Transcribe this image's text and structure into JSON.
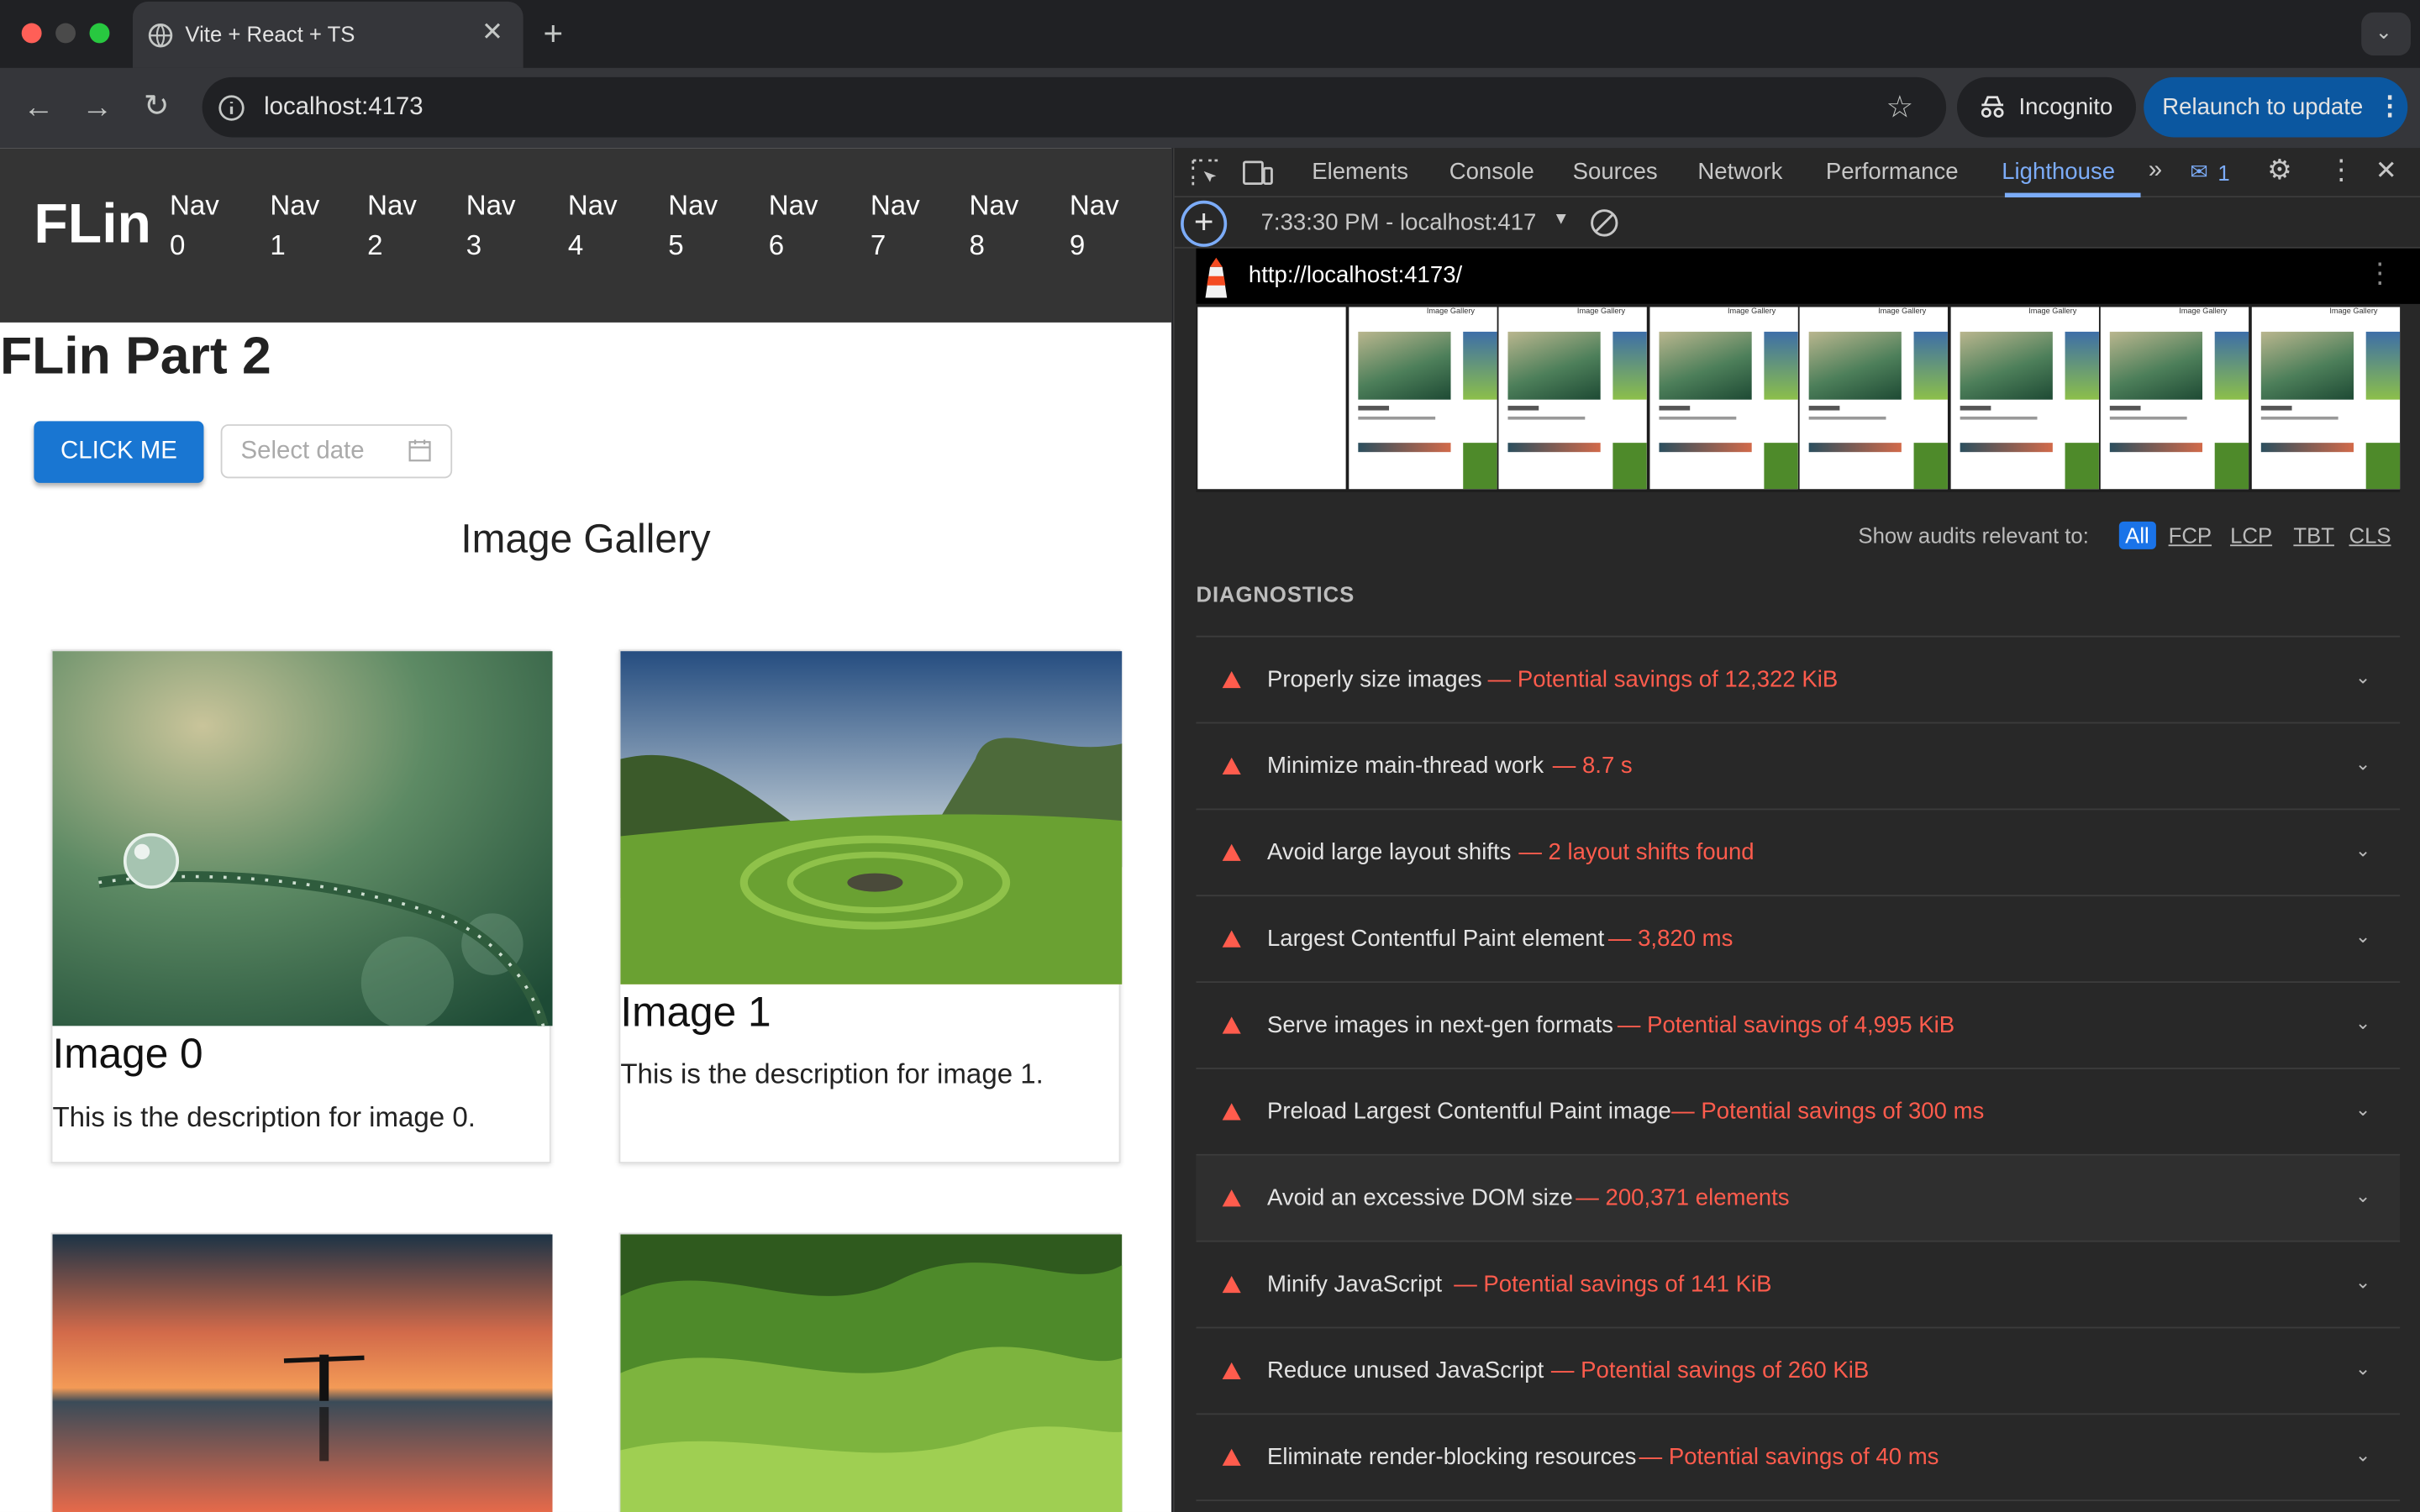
{
  "browser": {
    "tab_title": "Vite + React + TS",
    "url": "localhost:4173",
    "incognito_label": "Incognito",
    "relaunch_label": "Relaunch to update"
  },
  "app": {
    "logo": "FLin",
    "nav": [
      {
        "word": "Nav",
        "num": "0"
      },
      {
        "word": "Nav",
        "num": "1"
      },
      {
        "word": "Nav",
        "num": "2"
      },
      {
        "word": "Nav",
        "num": "3"
      },
      {
        "word": "Nav",
        "num": "4"
      },
      {
        "word": "Nav",
        "num": "5"
      },
      {
        "word": "Nav",
        "num": "6"
      },
      {
        "word": "Nav",
        "num": "7"
      },
      {
        "word": "Nav",
        "num": "8"
      },
      {
        "word": "Nav",
        "num": "9"
      }
    ],
    "heading": "FLin Part 2",
    "button_label": "CLICK ME",
    "date_placeholder": "Select date",
    "gallery_title": "Image Gallery",
    "cards": [
      {
        "title": "Image 0",
        "description": "This is the description for image 0."
      },
      {
        "title": "Image 1",
        "description": "This is the description for image 1."
      }
    ]
  },
  "devtools": {
    "tabs": [
      "Elements",
      "Console",
      "Sources",
      "Network",
      "Performance",
      "Lighthouse"
    ],
    "active_tab": "Lighthouse",
    "issues_count": "1",
    "report_label": "7:33:30 PM - localhost:417",
    "report_url": "http://localhost:4173/",
    "filmstrip_page_title": "Image Gallery",
    "filter_label": "Show audits relevant to:",
    "filters": [
      "All",
      "FCP",
      "LCP",
      "TBT",
      "CLS"
    ],
    "section_title": "DIAGNOSTICS",
    "audits": [
      {
        "title": "Properly size images",
        "value": "Potential savings of 12,322 KiB"
      },
      {
        "title": "Minimize main-thread work",
        "value": "8.7 s"
      },
      {
        "title": "Avoid large layout shifts",
        "value": "2 layout shifts found"
      },
      {
        "title": "Largest Contentful Paint element",
        "value": "3,820 ms"
      },
      {
        "title": "Serve images in next-gen formats",
        "value": "Potential savings of 4,995 KiB"
      },
      {
        "title": "Preload Largest Contentful Paint image",
        "value": "Potential savings of 300 ms"
      },
      {
        "title": "Avoid an excessive DOM size",
        "value": "200,371 elements"
      },
      {
        "title": "Minify JavaScript",
        "value": "Potential savings of 141 KiB"
      },
      {
        "title": "Reduce unused JavaScript",
        "value": "Potential savings of 260 KiB"
      },
      {
        "title": "Eliminate render-blocking resources",
        "value": "Potential savings of 40 ms"
      }
    ]
  },
  "colors": {
    "accent": "#1976d2",
    "devtools_accent": "#7cacf8",
    "warning": "#ff5c4d",
    "app_header": "#343434"
  }
}
